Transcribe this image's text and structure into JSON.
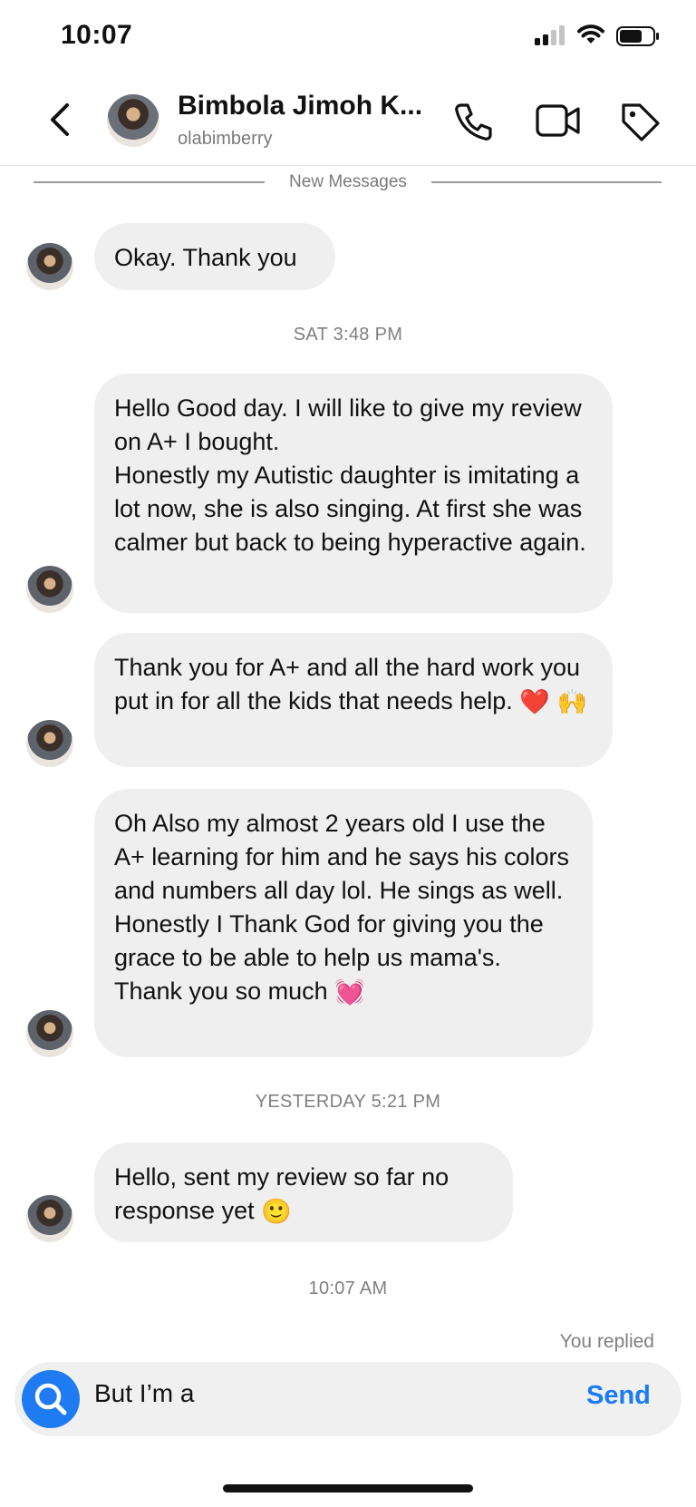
{
  "status_bar": {
    "time": "10:07"
  },
  "header": {
    "name": "Bimbola Jimoh K...",
    "handle": "olabimberry",
    "icons": [
      "back-arrow-icon",
      "phone-icon",
      "video-camera-icon",
      "tag-icon"
    ]
  },
  "new_messages_label": "New Messages",
  "messages": [
    {
      "text": [
        "Okay. Thank you"
      ]
    },
    {
      "timestamp": "SAT 3:48 PM"
    },
    {
      "text": [
        "Hello Good day. I will like to give my review on A+ I bought.",
        "Honestly my Autistic daughter is imitating a lot now, she is also singing. At first she was calmer but back to being hyperactive again."
      ]
    },
    {
      "text": [
        "Thank you for A+ and all the hard work you put in for all the kids that needs help."
      ],
      "emojis": [
        "❤️",
        "🙌"
      ]
    },
    {
      "text": [
        "Oh Also my almost 2 years old I use the A+ learning for him and he says his colors and numbers all day lol. He sings as well. Honestly I Thank God for giving you the grace to be able to help us mama's. Thank you so much"
      ],
      "emojis": [
        "💓"
      ]
    },
    {
      "timestamp": "YESTERDAY 5:21 PM"
    },
    {
      "text": [
        "Hello, sent my review so far no response yet"
      ],
      "emojis": [
        "🙂"
      ]
    },
    {
      "timestamp": "10:07 AM"
    }
  ],
  "you_replied_label": "You replied",
  "composer": {
    "value": "But I’m a",
    "send_label": "Send"
  },
  "colors": {
    "accent": "#1a7cf5",
    "bubble": "#efefef"
  }
}
